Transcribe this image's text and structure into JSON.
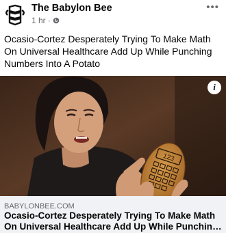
{
  "post": {
    "page_name": "The Babylon Bee",
    "time": "1 hr",
    "separator": "·",
    "more_label": "•••",
    "text": "Ocasio-Cortez Desperately Trying To Make Math On Universal Healthcare Add Up While Punching Numbers Into A Potato",
    "icons": {
      "avatar": "babylon-bee-logo",
      "privacy": "globe-icon",
      "more": "more-options-icon",
      "info": "info-icon"
    }
  },
  "image": {
    "calculator_display": "123",
    "info_label": "i"
  },
  "link_preview": {
    "domain": "BABYLONBEE.COM",
    "title": "Ocasio-Cortez Desperately Trying To Make Math On Universal Healthcare Add Up While Punching Numbers Into A Potato"
  }
}
